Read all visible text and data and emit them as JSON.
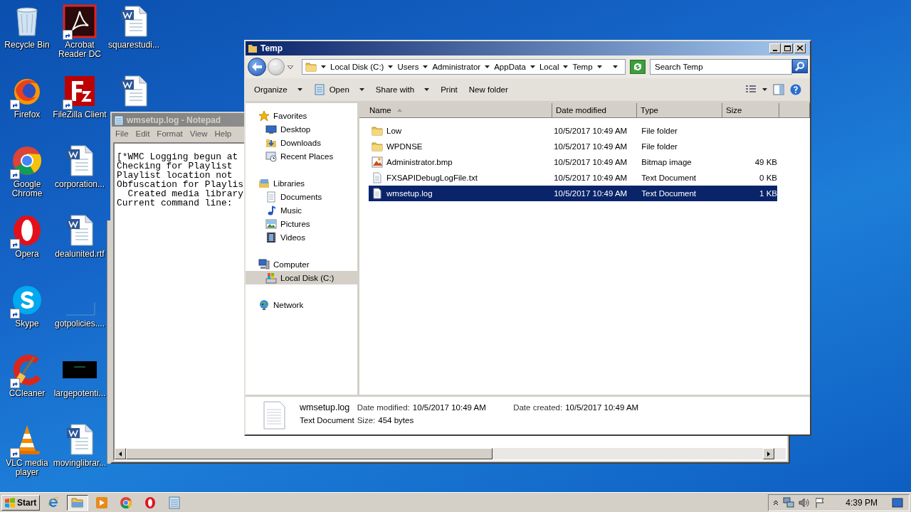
{
  "desktop_icons": [
    {
      "label": "Recycle Bin",
      "kind": "recycle",
      "shortcut": false
    },
    {
      "label": "Firefox",
      "kind": "firefox",
      "shortcut": true
    },
    {
      "label": "Google Chrome",
      "kind": "chrome",
      "shortcut": true
    },
    {
      "label": "Opera",
      "kind": "opera",
      "shortcut": true
    },
    {
      "label": "Skype",
      "kind": "skype",
      "shortcut": true
    },
    {
      "label": "CCleaner",
      "kind": "ccleaner",
      "shortcut": true
    },
    {
      "label": "VLC media player",
      "kind": "vlc",
      "shortcut": true
    },
    {
      "label": "Acrobat Reader DC",
      "kind": "acrobat",
      "shortcut": true
    },
    {
      "label": "FileZilla Client",
      "kind": "filezilla",
      "shortcut": true
    },
    {
      "label": "corporation...",
      "kind": "word",
      "shortcut": false
    },
    {
      "label": "dealunited.rtf",
      "kind": "word",
      "shortcut": false
    },
    {
      "label": "gotpolicies....",
      "kind": "blank",
      "shortcut": false
    },
    {
      "label": "largepotenti...",
      "kind": "dark",
      "shortcut": false
    },
    {
      "label": "movinglibrar...",
      "kind": "word",
      "shortcut": false
    },
    {
      "label": "squarestudi...",
      "kind": "word",
      "shortcut": false
    },
    {
      "kind": "word",
      "shortcut": false
    }
  ],
  "notepad": {
    "title": "wmsetup.log - Notepad",
    "menu": [
      "File",
      "Edit",
      "Format",
      "View",
      "Help"
    ],
    "lines": [
      "[*WMC Logging begun at",
      "Checking for Playlist",
      "Playlist location not",
      "Obfuscation for Playlis",
      "  Created media library",
      "Current command line:"
    ]
  },
  "explorer": {
    "title": "Temp",
    "breadcrumb": [
      "Local Disk (C:)",
      "Users",
      "Administrator",
      "AppData",
      "Local",
      "Temp"
    ],
    "search": {
      "placeholder": "Search Temp"
    },
    "toolbar": [
      {
        "label": "Organize",
        "kind": "menu",
        "icon": false
      },
      {
        "label": "Open",
        "kind": "menu",
        "icon": true
      },
      {
        "label": "Share with",
        "kind": "menu",
        "icon": false
      },
      {
        "label": "Print",
        "kind": "plain",
        "icon": false
      },
      {
        "label": "New folder",
        "kind": "plain",
        "icon": false
      }
    ],
    "nav": [
      {
        "label": "Favorites",
        "kind": "star",
        "selected": false,
        "children": [
          {
            "label": "Desktop",
            "kind": "desktop",
            "selected": false
          },
          {
            "label": "Downloads",
            "kind": "downloads",
            "selected": false
          },
          {
            "label": "Recent Places",
            "kind": "recent",
            "selected": false
          }
        ]
      },
      {
        "label": "Libraries",
        "kind": "library",
        "selected": false,
        "children": [
          {
            "label": "Documents",
            "kind": "documents",
            "selected": false
          },
          {
            "label": "Music",
            "kind": "music",
            "selected": false
          },
          {
            "label": "Pictures",
            "kind": "pictures",
            "selected": false
          },
          {
            "label": "Videos",
            "kind": "videos",
            "selected": false
          }
        ]
      },
      {
        "label": "Computer",
        "kind": "computer",
        "selected": false,
        "children": [
          {
            "label": "Local Disk (C:)",
            "kind": "disk",
            "selected": true
          }
        ]
      },
      {
        "label": "Network",
        "kind": "network",
        "selected": false
      }
    ],
    "columns": [
      {
        "label": "Name",
        "sorted": true
      },
      {
        "label": "Date modified",
        "sorted": false
      },
      {
        "label": "Type",
        "sorted": false
      },
      {
        "label": "Size",
        "sorted": false
      }
    ],
    "files": [
      {
        "name": "Low",
        "kind": "folder",
        "date": "10/5/2017 10:49 AM",
        "type": "File folder",
        "selected": false
      },
      {
        "name": "WPDNSE",
        "kind": "folder",
        "date": "10/5/2017 10:49 AM",
        "type": "File folder",
        "selected": false
      },
      {
        "name": "Administrator.bmp",
        "kind": "bmp",
        "date": "10/5/2017 10:49 AM",
        "type": "Bitmap image",
        "size": "49 KB",
        "selected": false
      },
      {
        "name": "FXSAPIDebugLogFile.txt",
        "kind": "txt",
        "date": "10/5/2017 10:49 AM",
        "type": "Text Document",
        "size": "0 KB",
        "selected": false
      },
      {
        "name": "wmsetup.log",
        "kind": "txt",
        "date": "10/5/2017 10:49 AM",
        "type": "Text Document",
        "size": "1 KB",
        "selected": true
      }
    ],
    "details": {
      "name": "wmsetup.log",
      "type": "Text Document",
      "modified_label": "Date modified:",
      "modified": "10/5/2017 10:49 AM",
      "created_label": "Date created:",
      "created": "10/5/2017 10:49 AM",
      "size_label": "Size:",
      "size": "454 bytes"
    }
  },
  "taskbar": {
    "start": "Start",
    "items": [
      {
        "kind": "ie",
        "active": false
      },
      {
        "kind": "explorer",
        "active": true
      },
      {
        "kind": "player",
        "active": false
      },
      {
        "kind": "chrome",
        "active": false
      },
      {
        "kind": "opera",
        "active": false
      },
      {
        "kind": "notepad",
        "active": false
      }
    ],
    "clock": "4:39 PM"
  }
}
